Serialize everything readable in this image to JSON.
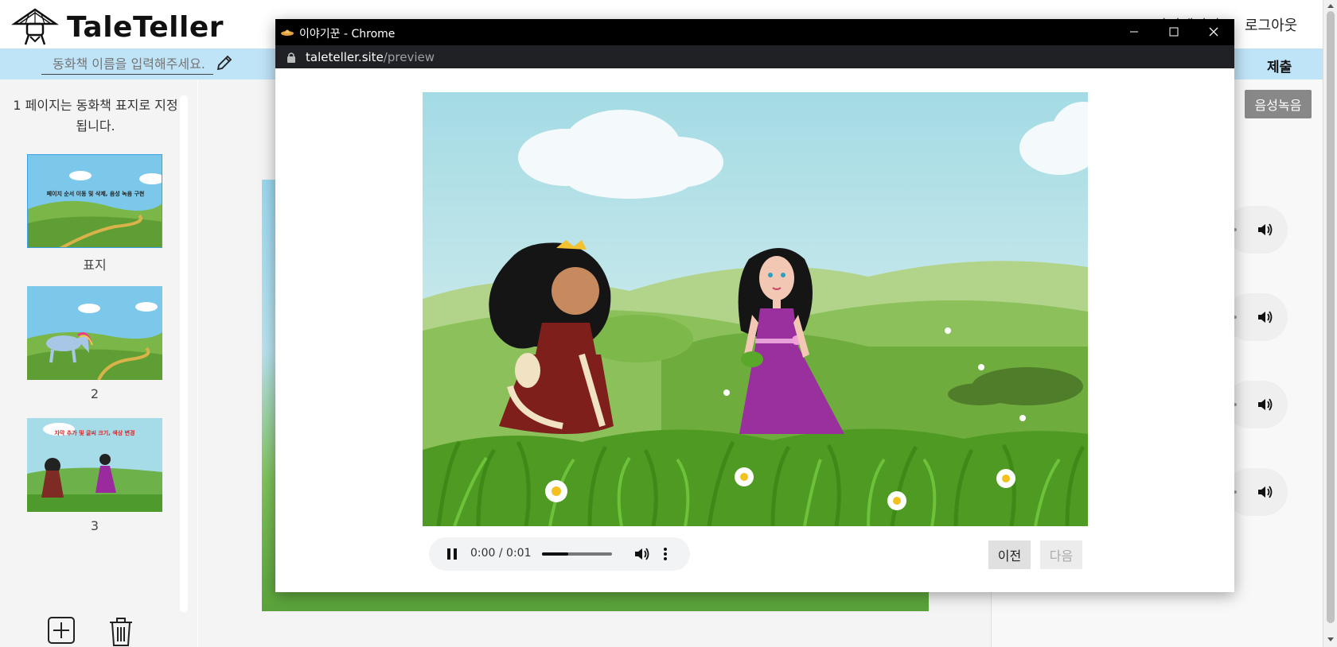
{
  "app": {
    "brand": "TaleTeller",
    "header_links": [
      "마이페이지",
      "로그아웃"
    ]
  },
  "title_bar": {
    "title_placeholder": "동화책 이름을 입력해주세요.",
    "submit_label": "제출"
  },
  "sidebar": {
    "note": "1 페이지는 동화책 표지로 지정됩니다.",
    "pages": [
      {
        "label": "표지",
        "caption": "페이지 순서 이동 및 삭제, 음성 녹음 구현",
        "selected": true
      },
      {
        "label": "2",
        "caption": "",
        "selected": false
      },
      {
        "label": "3",
        "caption": "자막 추가 및 글씨 크기, 색상 변경",
        "selected": false
      }
    ]
  },
  "right_panel": {
    "record_label": "음성녹음",
    "audio_items": 4
  },
  "popup": {
    "window_title": "이야기꾼 - Chrome",
    "url_host": "taleteller.site",
    "url_path": "/preview",
    "player": {
      "time": "0:00 / 0:01",
      "volume_level": 0.38,
      "state": "playing"
    },
    "prev_label": "이전",
    "next_label": "다음"
  },
  "colors": {
    "title_bar": "#bfe3f7",
    "selected_thumb_border": "#3aa0e8",
    "popup_titlebar": "#000000",
    "urlbar": "#202124"
  }
}
